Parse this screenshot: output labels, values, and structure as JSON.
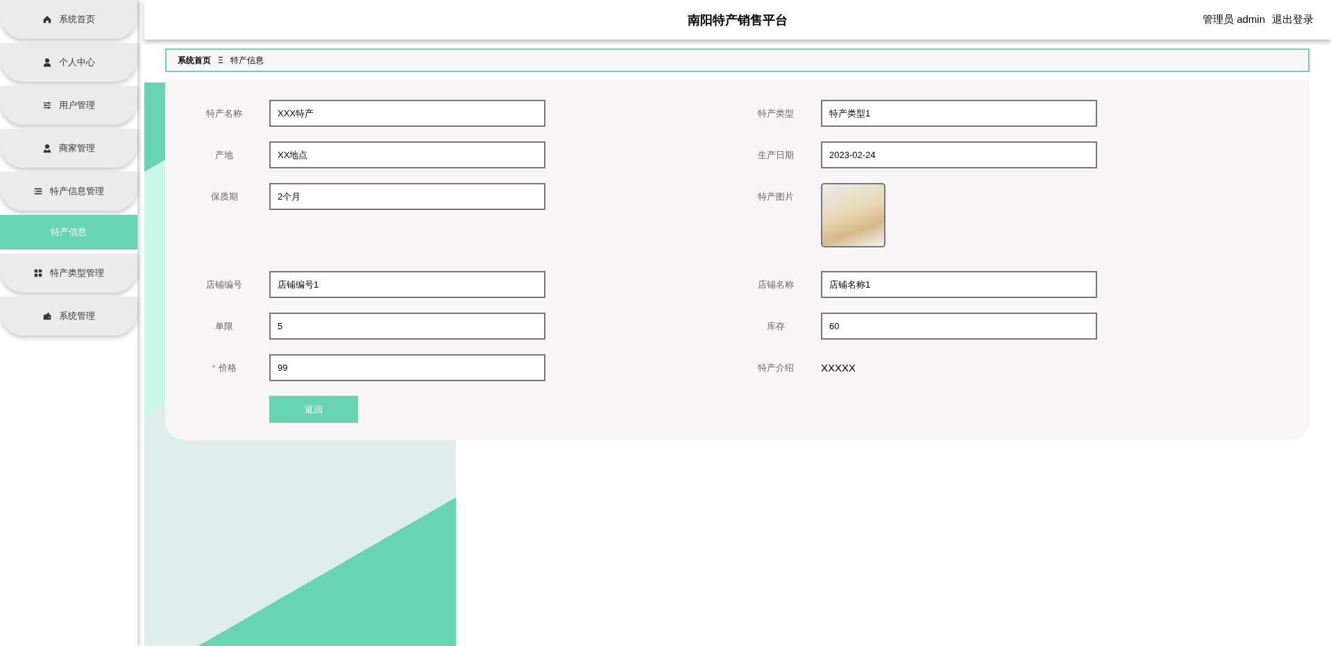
{
  "sidebar": {
    "items": [
      {
        "label": "系统首页",
        "selected": false
      },
      {
        "label": "个人中心",
        "selected": false
      },
      {
        "label": "用户管理",
        "selected": false
      },
      {
        "label": "商家管理",
        "selected": false
      },
      {
        "label": "特产信息管理",
        "selected": false,
        "children": [
          {
            "label": "特产信息",
            "selected": true
          }
        ]
      },
      {
        "label": "特产类型管理",
        "selected": false
      },
      {
        "label": "系统管理",
        "selected": false
      }
    ]
  },
  "header": {
    "title": "南阳特产销售平台",
    "user": "管理员 admin",
    "logout": "退出登录"
  },
  "breadcrumb": {
    "items": [
      "系统首页",
      "特产信息"
    ],
    "separator": "Ξ"
  },
  "form": {
    "rows": [
      {
        "left": {
          "kind": "input",
          "label": "特产名称",
          "value": "XXX特产",
          "required": false
        },
        "right": {
          "kind": "input",
          "label": "特产类型",
          "value": "特产类型1",
          "required": false
        }
      },
      {
        "left": {
          "kind": "input",
          "label": "产地",
          "value": "XX地点",
          "required": false
        },
        "right": {
          "kind": "input",
          "label": "生产日期",
          "value": "2023-02-24",
          "required": false
        }
      },
      {
        "left": {
          "kind": "input",
          "label": "保质期",
          "value": "2个月",
          "required": false
        },
        "right": {
          "kind": "image",
          "label": "特产图片",
          "required": false
        }
      },
      {
        "left": {
          "kind": "input",
          "label": "店铺编号",
          "value": "店铺编号1",
          "required": false
        },
        "right": {
          "kind": "input",
          "label": "店铺名称",
          "value": "店铺名称1",
          "required": false
        }
      },
      {
        "left": {
          "kind": "input",
          "label": "单限",
          "value": "5",
          "required": false
        },
        "right": {
          "kind": "input",
          "label": "库存",
          "value": "60",
          "required": false
        }
      },
      {
        "left": {
          "kind": "input",
          "label": "价格",
          "value": "99",
          "required": true
        },
        "right": {
          "kind": "text",
          "label": "特产介绍",
          "value": "XXXXX",
          "required": false
        }
      }
    ],
    "required_mark": "*",
    "button": "返回"
  }
}
